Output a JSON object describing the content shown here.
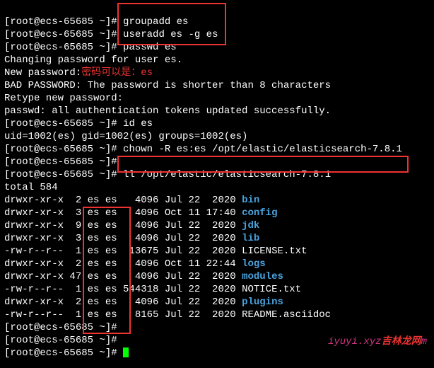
{
  "prompt": "[root@ecs-65685 ~]#",
  "cmds": {
    "groupadd": "groupadd es",
    "useradd": "useradd es -g es",
    "passwd": "passwd es",
    "id": "id es",
    "chown": "chown -R es:es /opt/elastic/elasticsearch-7.8.1",
    "ll": "ll /opt/elastic/elasticsearch-7.8.1"
  },
  "out": {
    "changing": "Changing password for user es.",
    "newpass_label": "New password:",
    "anno_cn": "密码可以是：",
    "anno_pw": "es",
    "bad": "BAD PASSWORD: The password is shorter than 8 characters",
    "retype": "Retype new password:",
    "auth_ok": "passwd: all authentication tokens updated successfully.",
    "idout": "uid=1002(es) gid=1002(es) groups=1002(es)",
    "total": "total 584"
  },
  "listing": [
    {
      "perm": "drwxr-xr-x",
      "n": " 2",
      "u": "es",
      "g": "es",
      "size": "  4096",
      "date": "Jul 22  2020",
      "name": "bin",
      "is_dir": true
    },
    {
      "perm": "drwxr-xr-x",
      "n": " 3",
      "u": "es",
      "g": "es",
      "size": "  4096",
      "date": "Oct 11 17:40",
      "name": "config",
      "is_dir": true
    },
    {
      "perm": "drwxr-xr-x",
      "n": " 9",
      "u": "es",
      "g": "es",
      "size": "  4096",
      "date": "Jul 22  2020",
      "name": "jdk",
      "is_dir": true
    },
    {
      "perm": "drwxr-xr-x",
      "n": " 3",
      "u": "es",
      "g": "es",
      "size": "  4096",
      "date": "Jul 22  2020",
      "name": "lib",
      "is_dir": true
    },
    {
      "perm": "-rw-r--r--",
      "n": " 1",
      "u": "es",
      "g": "es",
      "size": " 13675",
      "date": "Jul 22  2020",
      "name": "LICENSE.txt",
      "is_dir": false
    },
    {
      "perm": "drwxr-xr-x",
      "n": " 2",
      "u": "es",
      "g": "es",
      "size": "  4096",
      "date": "Oct 11 22:44",
      "name": "logs",
      "is_dir": true
    },
    {
      "perm": "drwxr-xr-x",
      "n": "47",
      "u": "es",
      "g": "es",
      "size": "  4096",
      "date": "Jul 22  2020",
      "name": "modules",
      "is_dir": true
    },
    {
      "perm": "-rw-r--r--",
      "n": " 1",
      "u": "es",
      "g": "es",
      "size": "544318",
      "date": "Jul 22  2020",
      "name": "NOTICE.txt",
      "is_dir": false
    },
    {
      "perm": "drwxr-xr-x",
      "n": " 2",
      "u": "es",
      "g": "es",
      "size": "  4096",
      "date": "Jul 22  2020",
      "name": "plugins",
      "is_dir": true
    },
    {
      "perm": "-rw-r--r--",
      "n": " 1",
      "u": "es",
      "g": "es",
      "size": "  8165",
      "date": "Jul 22  2020",
      "name": "README.asciidoc",
      "is_dir": false
    }
  ],
  "watermark": {
    "a": "iyuyi.xyz",
    "b": "吉林龙网",
    "c": "m"
  }
}
